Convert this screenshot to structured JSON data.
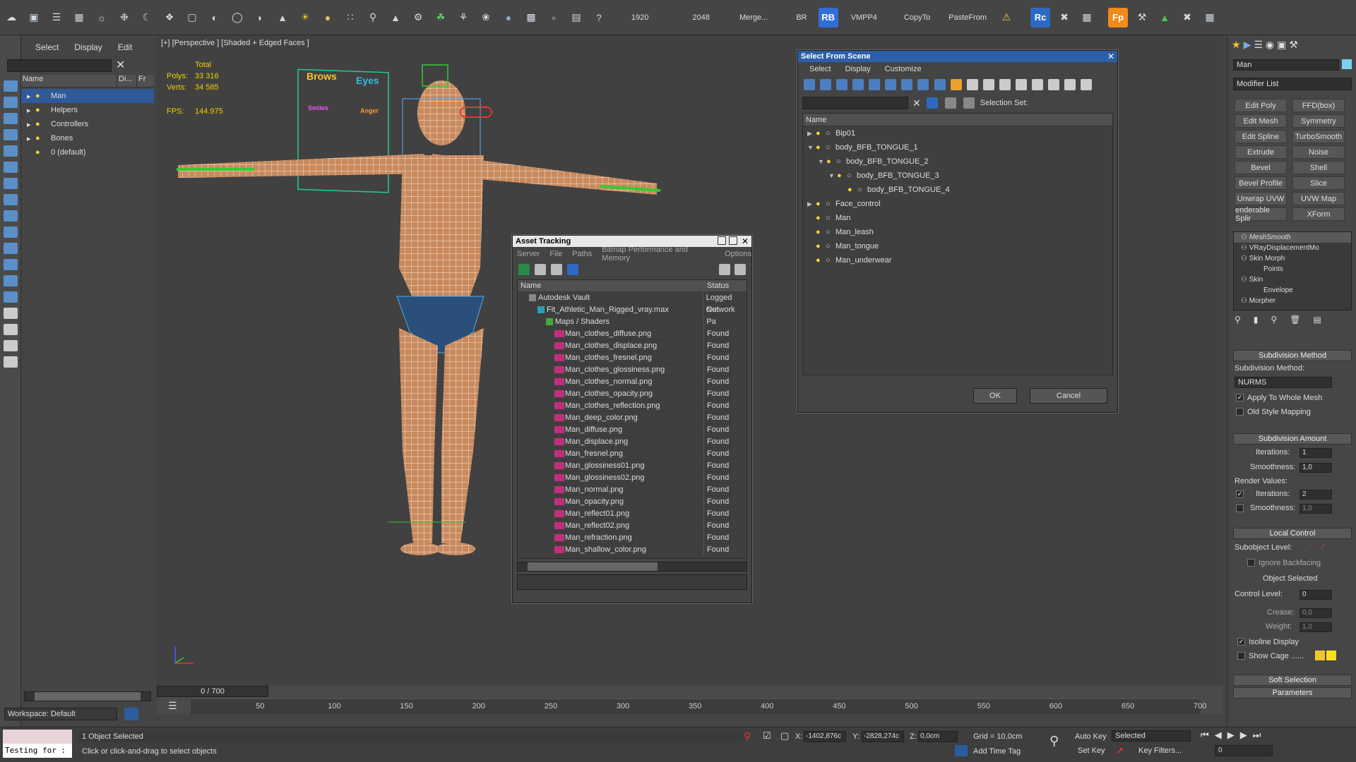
{
  "toolbar": {
    "res1": "1920",
    "res2": "2048",
    "merge": "Merge...",
    "br": "BR",
    "rb": "RB",
    "vmpp": "VMPP4",
    "copyto": "CopyTo",
    "pastefrom": "PasteFrom",
    "rc": "Rc",
    "fp": "Fp"
  },
  "explorer": {
    "menu": [
      "Select",
      "Display",
      "Edit"
    ],
    "col_name": "Name",
    "col_display": "Di...",
    "col_fr": "Fr",
    "items": [
      "Man",
      "Helpers",
      "Controllers",
      "Bones",
      "0 (default)"
    ],
    "workspace": "Workspace: Default"
  },
  "viewport": {
    "label": "[+] [Perspective ] [Shaded + Edged Faces ]",
    "stats_title": "Total",
    "polys_label": "Polys:",
    "polys": "33 316",
    "verts_label": "Verts:",
    "verts": "34 585",
    "fps_label": "FPS:",
    "fps": "144.975"
  },
  "face_rig": {
    "brows": "Brows",
    "eyes": "Eyes",
    "smiles": "Smiles",
    "anger": "Anger"
  },
  "select_dialog": {
    "title": "Select From Scene",
    "menu": [
      "Select",
      "Display",
      "Customize"
    ],
    "selection_set": "Selection Set:",
    "col_name": "Name",
    "rows": [
      {
        "name": "Bip01",
        "indent": 0,
        "arrow": "▶"
      },
      {
        "name": "body_BFB_TONGUE_1",
        "indent": 0,
        "arrow": "▼"
      },
      {
        "name": "body_BFB_TONGUE_2",
        "indent": 1,
        "arrow": "▼"
      },
      {
        "name": "body_BFB_TONGUE_3",
        "indent": 2,
        "arrow": "▼"
      },
      {
        "name": "body_BFB_TONGUE_4",
        "indent": 3,
        "arrow": ""
      },
      {
        "name": "Face_control",
        "indent": 0,
        "arrow": "▶"
      },
      {
        "name": "Man",
        "indent": 0,
        "arrow": ""
      },
      {
        "name": "Man_leash",
        "indent": 0,
        "arrow": ""
      },
      {
        "name": "Man_tongue",
        "indent": 0,
        "arrow": ""
      },
      {
        "name": "Man_underwear",
        "indent": 0,
        "arrow": ""
      }
    ],
    "ok": "OK",
    "cancel": "Cancel"
  },
  "asset_dialog": {
    "title": "Asset Tracking",
    "menu": [
      "Server",
      "File",
      "Paths",
      "Bitmap Performance and Memory",
      "Options"
    ],
    "col_name": "Name",
    "col_status": "Status",
    "rows": [
      {
        "name": "Autodesk Vault",
        "status": "Logged Out",
        "kind": "vault",
        "indent": 1
      },
      {
        "name": "Fit_Athletic_Man_Rigged_vray.max",
        "status": "Network Pa",
        "kind": "max",
        "indent": 2
      },
      {
        "name": "Maps / Shaders",
        "status": "",
        "kind": "folder",
        "indent": 3
      },
      {
        "name": "Man_clothes_diffuse.png",
        "status": "Found",
        "kind": "png",
        "indent": 4
      },
      {
        "name": "Man_clothes_displace.png",
        "status": "Found",
        "kind": "png",
        "indent": 4
      },
      {
        "name": "Man_clothes_fresnel.png",
        "status": "Found",
        "kind": "png",
        "indent": 4
      },
      {
        "name": "Man_clothes_glossiness.png",
        "status": "Found",
        "kind": "png",
        "indent": 4
      },
      {
        "name": "Man_clothes_normal.png",
        "status": "Found",
        "kind": "png",
        "indent": 4
      },
      {
        "name": "Man_clothes_opacity.png",
        "status": "Found",
        "kind": "png",
        "indent": 4
      },
      {
        "name": "Man_clothes_reflection.png",
        "status": "Found",
        "kind": "png",
        "indent": 4
      },
      {
        "name": "Man_deep_color.png",
        "status": "Found",
        "kind": "png",
        "indent": 4
      },
      {
        "name": "Man_diffuse.png",
        "status": "Found",
        "kind": "png",
        "indent": 4
      },
      {
        "name": "Man_displace.png",
        "status": "Found",
        "kind": "png",
        "indent": 4
      },
      {
        "name": "Man_fresnel.png",
        "status": "Found",
        "kind": "png",
        "indent": 4
      },
      {
        "name": "Man_glossiness01.png",
        "status": "Found",
        "kind": "png",
        "indent": 4
      },
      {
        "name": "Man_glossiness02.png",
        "status": "Found",
        "kind": "png",
        "indent": 4
      },
      {
        "name": "Man_normal.png",
        "status": "Found",
        "kind": "png",
        "indent": 4
      },
      {
        "name": "Man_opacity.png",
        "status": "Found",
        "kind": "png",
        "indent": 4
      },
      {
        "name": "Man_reflect01.png",
        "status": "Found",
        "kind": "png",
        "indent": 4
      },
      {
        "name": "Man_reflect02.png",
        "status": "Found",
        "kind": "png",
        "indent": 4
      },
      {
        "name": "Man_refraction.png",
        "status": "Found",
        "kind": "png",
        "indent": 4
      },
      {
        "name": "Man_shallow_color.png",
        "status": "Found",
        "kind": "png",
        "indent": 4
      }
    ]
  },
  "command_panel": {
    "object_name": "Man",
    "modifier_list": "Modifier List",
    "buttons": [
      "Edit Poly",
      "FFD(box)",
      "Edit Mesh",
      "Symmetry",
      "Edit Spline",
      "TurboSmooth",
      "Extrude",
      "Noise",
      "Bevel",
      "Shell",
      "Bevel Profile",
      "Slice",
      "Unwrap UVW",
      "UVW Map",
      "enderable Splir",
      "XForm"
    ],
    "stack": [
      {
        "name": "MeshSmooth",
        "sub": false
      },
      {
        "name": "VRayDisplacementMo",
        "sub": false
      },
      {
        "name": "Skin Morph",
        "sub": false
      },
      {
        "name": "Points",
        "sub": true
      },
      {
        "name": "Skin",
        "sub": false
      },
      {
        "name": "Envelope",
        "sub": true
      },
      {
        "name": "Morpher",
        "sub": false
      }
    ],
    "subdivision_method_title": "Subdivision Method",
    "subdivision_method_label": "Subdivision Method:",
    "subdivision_method_value": "NURMS",
    "apply_whole": "Apply To Whole Mesh",
    "old_style": "Old Style Mapping",
    "subdivision_amount_title": "Subdivision Amount",
    "iterations_label": "Iterations:",
    "iterations": "1",
    "smoothness_label": "Smoothness:",
    "smoothness": "1,0",
    "render_values": "Render Values:",
    "r_iterations": "2",
    "r_smoothness": "1,0",
    "local_control_title": "Local Control",
    "subobject_level": "Subobject Level:",
    "ignore_backfacing": "Ignore Backfacing",
    "object_selected": "Object Selected",
    "control_level_label": "Control Level:",
    "control_level": "0",
    "crease_label": "Crease:",
    "crease": "0,0",
    "weight_label": "Weight:",
    "weight": "1,0",
    "isoline": "Isoline Display",
    "show_cage": "Show Cage ......",
    "soft_selection": "Soft Selection",
    "parameters": "Parameters"
  },
  "timeline": {
    "frame": "0 / 700",
    "ticks": [
      "50",
      "100",
      "150",
      "200",
      "250",
      "300",
      "350",
      "400",
      "450",
      "500",
      "550",
      "600",
      "650",
      "700"
    ]
  },
  "status": {
    "script": "Testing for :",
    "selected": "1 Object Selected",
    "prompt": "Click or click-and-drag to select objects",
    "x_label": "X:",
    "x": "-1402,876c",
    "y_label": "Y:",
    "y": "-2828,274c",
    "z_label": "Z:",
    "z": "0,0cm",
    "grid": "Grid = 10,0cm",
    "add_time_tag": "Add Time Tag",
    "auto_key": "Auto Key",
    "set_key": "Set Key",
    "key_selected": "Selected",
    "key_filters": "Key Filters...",
    "frame_field": "0"
  }
}
